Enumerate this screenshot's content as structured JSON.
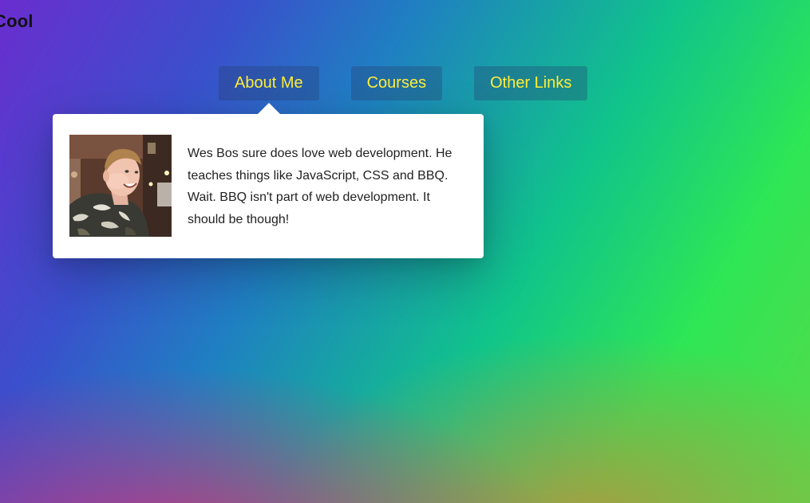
{
  "site": {
    "title": "Cool"
  },
  "nav": {
    "items": [
      {
        "label": "About Me"
      },
      {
        "label": "Courses"
      },
      {
        "label": "Other Links"
      }
    ]
  },
  "dropdown": {
    "avatar_icon": "profile-photo",
    "bio": "Wes Bos sure does love web development. He teaches things like JavaScript, CSS and BBQ. Wait. BBQ isn't part of web development. It should be though!"
  },
  "colors": {
    "nav_text": "#ffee3a",
    "dropdown_bg": "#ffffff",
    "gradient": [
      "#6a2dcf",
      "#1f7fc2",
      "#10c48a",
      "#2ee655",
      "#ff1470",
      "#cd873c"
    ]
  }
}
